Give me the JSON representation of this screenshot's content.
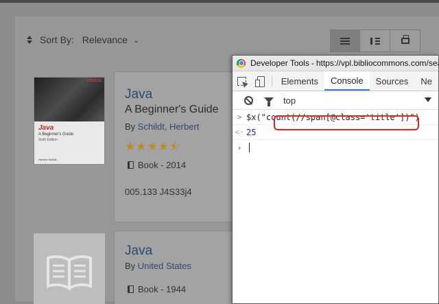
{
  "catalog": {
    "sort": {
      "label": "Sort By:",
      "value": "Relevance"
    },
    "view_buttons": [
      "list-view",
      "compact-view",
      "print"
    ],
    "results": [
      {
        "title": "Java",
        "subtitle": "A Beginner's Guide",
        "by_prefix": "By",
        "author": "Schildt, Herbert",
        "rating_stars": "★★★★⯪",
        "format": "Book - 2014",
        "call_number": "005.133 J4S33j4",
        "cover": {
          "brand": "ORACLE",
          "title": "Java",
          "subtitle": "A Beginner's Guide",
          "edition": "Sixth Edition",
          "author": "Herbert Schildt"
        }
      },
      {
        "title": "Java",
        "by_prefix": "By",
        "author": "United States",
        "format": "Book - 1944"
      }
    ]
  },
  "devtools": {
    "window_title": "Developer Tools",
    "url": "https://vpl.bibliocommons.com/search?q",
    "tabs": [
      "Elements",
      "Console",
      "Sources",
      "Ne"
    ],
    "active_tab": "Console",
    "context": "top",
    "console": {
      "input_fn": "$x(\"",
      "input_arg": "count(//span[@class='title'])",
      "input_close": "\")",
      "result": "25"
    }
  },
  "colors": {
    "link": "#2d4a6e",
    "stars": "#b98a25",
    "tab_underline": "#3879d9",
    "highlight": "#e5201d",
    "console_string": "#c41a16",
    "console_number": "#1a1aa6"
  }
}
